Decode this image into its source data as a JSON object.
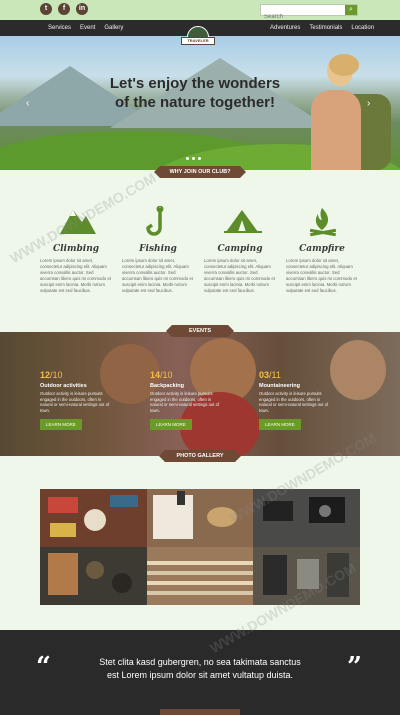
{
  "topbar": {
    "social": [
      "t",
      "f",
      "in"
    ],
    "search_placeholder": "Search",
    "search_button_icon": "search-icon"
  },
  "nav": {
    "left": [
      "Services",
      "Event",
      "Gallery"
    ],
    "right": [
      "Adventures",
      "Testimonials",
      "Location"
    ],
    "logo_text": "TRAVELER"
  },
  "hero": {
    "title_line1": "Let's enjoy the wonders",
    "title_line2": "of the nature together!",
    "prev": "‹",
    "next": "›",
    "join_label": "WHY JOIN OUR CLUB?"
  },
  "features": [
    {
      "title": "Climbing",
      "icon": "mountain-icon",
      "text": "Lorem ipsum dolor sit amet, consectetur adipiscing elit. Aliquam viverra convallis auctor. Sed accumsan libero quis mi commodo et suscipit enim lacinia. Morbi rutrum vulputate est sed faucibus."
    },
    {
      "title": "Fishing",
      "icon": "fish-hook-icon",
      "text": "Lorem ipsum dolor sit amet, consectetur adipiscing elit. Aliquam viverra convallis auctor. Sed accumsan libero quis mi commodo et suscipit enim lacinia. Morbi rutrum vulputate est sed faucibus."
    },
    {
      "title": "Camping",
      "icon": "tent-icon",
      "text": "Lorem ipsum dolor sit amet, consectetur adipiscing elit. Aliquam viverra convallis auctor. Sed accumsan libero quis mi commodo et suscipit enim lacinia. Morbi rutrum vulputate est sed faucibus."
    },
    {
      "title": "Campfire",
      "icon": "campfire-icon",
      "text": "Lorem ipsum dolor sit amet, consectetur adipiscing elit. Aliquam viverra convallis auctor. Sed accumsan libero quis mi commodo et suscipit enim lacinia. Morbi rutrum vulputate est sed faucibus."
    }
  ],
  "events": {
    "label": "EVENTS",
    "items": [
      {
        "day": "12",
        "month": "10",
        "title": "Outdoor activities",
        "text": "Outdoor activity is leisure pursuits engaged in the outdoors, often in natural or semi-natural settings out of town.",
        "button": "LEARN MORE"
      },
      {
        "day": "14",
        "month": "10",
        "title": "Backpacking",
        "text": "Outdoor activity is leisure pursuits engaged in the outdoors, often in natural or semi-natural settings out of town.",
        "button": "LEARN MORE"
      },
      {
        "day": "03",
        "month": "11",
        "title": "Mountaineering",
        "text": "Outdoor activity is leisure pursuits engaged in the outdoors, often in natural or semi-natural settings out of town.",
        "button": "LEARN MORE"
      }
    ]
  },
  "gallery": {
    "label": "PHOTO GALLERY"
  },
  "quote": {
    "open_mark": "“",
    "close_mark": "”",
    "line1": "Stet clita kasd gubergren, no sea takimata sanctus",
    "line2": "est Lorem ipsum dolor sit amet vultatup duista."
  },
  "watermark": "WWW.DOWNDEMO.COM",
  "colors": {
    "accent_green": "#6a9a2a",
    "brown": "#6e4a36",
    "date_yellow": "#f5c04a",
    "dark": "#2a2a2a"
  }
}
